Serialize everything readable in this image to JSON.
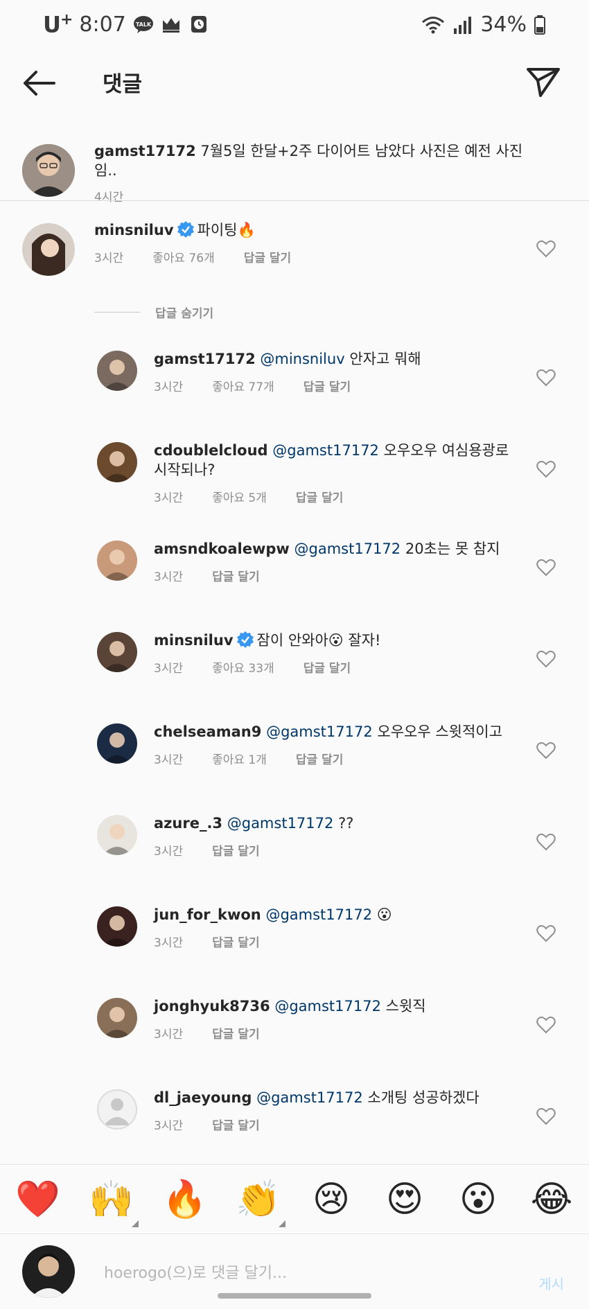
{
  "status_bar": {
    "carrier": "U",
    "carrier_sup": "+",
    "time": "8:07",
    "battery": "34%"
  },
  "header": {
    "title": "댓글"
  },
  "caption": {
    "username": "gamst17172",
    "text": "7월5일 한달+2주 다이어트 남았다 사진은 예전 사진임..",
    "time": "4시간"
  },
  "top_comment": {
    "username": "minsniluv",
    "verified": true,
    "text": "파이팅🔥",
    "time": "3시간",
    "likes": "좋아요 76개",
    "reply": "답글 달기"
  },
  "hide_replies_label": "답글 숨기기",
  "replies": [
    {
      "username": "gamst17172",
      "mention": "@minsniluv",
      "text": "안자고 뭐해",
      "time": "3시간",
      "likes": "좋아요 77개",
      "reply": "답글 달기",
      "avatar_color": "#7a6a60"
    },
    {
      "username": "cdoublelcloud",
      "mention": "@gamst17172",
      "text": "오우오우 여심용광로 시작되나?",
      "time": "3시간",
      "likes": "좋아요 5개",
      "reply": "답글 달기",
      "avatar_color": "#6b4a2e"
    },
    {
      "username": "amsndkoalewpw",
      "mention": "@gamst17172",
      "text": "20초는 못 참지",
      "time": "3시간",
      "likes": "",
      "reply": "답글 달기",
      "avatar_color": "#c89a7a"
    },
    {
      "username": "minsniluv",
      "mention": "",
      "text": "잠이 안와아😮 잘자!",
      "time": "3시간",
      "likes": "좋아요 33개",
      "reply": "답글 달기",
      "verified": true,
      "avatar_color": "#5a4438"
    },
    {
      "username": "chelseaman9",
      "mention": "@gamst17172",
      "text": "오우오우 스윗적이고",
      "time": "3시간",
      "likes": "좋아요 1개",
      "reply": "답글 달기",
      "avatar_color": "#1c2b44"
    },
    {
      "username": "azure_.3",
      "mention": "@gamst17172",
      "text": "??",
      "time": "3시간",
      "likes": "",
      "reply": "답글 달기",
      "avatar_color": "#e8e4de"
    },
    {
      "username": "jun_for_kwon",
      "mention": "@gamst17172",
      "text": "😮",
      "time": "3시간",
      "likes": "",
      "reply": "답글 달기",
      "avatar_color": "#3a2220"
    },
    {
      "username": "jonghyuk8736",
      "mention": "@gamst17172",
      "text": " 스윗직",
      "time": "3시간",
      "likes": "",
      "reply": "답글 달기",
      "avatar_color": "#8a6f58"
    },
    {
      "username": "dl_jaeyoung",
      "mention": "@gamst17172",
      "text": "소개팅 성공하겠다",
      "time": "3시간",
      "likes": "",
      "reply": "답글 달기",
      "avatar_color": "#dcdcdc"
    }
  ],
  "emoji_bar": [
    "❤️",
    "🙌",
    "🔥",
    "👏",
    "😢",
    "😍",
    "😮",
    "😂"
  ],
  "composer": {
    "placeholder": "hoerogo(으)로 댓글 달기...",
    "post_label": "게시"
  }
}
